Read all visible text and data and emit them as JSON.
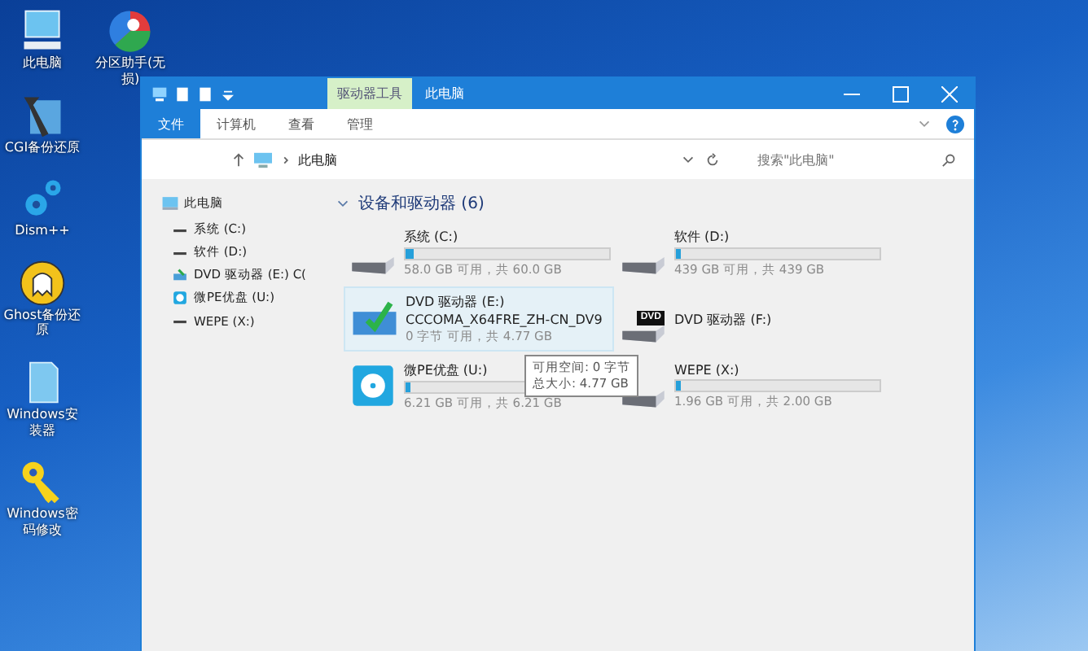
{
  "desktop_icons": [
    {
      "kind": "pc",
      "label": "此电脑"
    },
    {
      "kind": "partition",
      "label": "分区助手(无损)"
    },
    {
      "kind": "tool",
      "label": "CGI备份还原"
    },
    {
      "kind": "gears",
      "label": "Dism++"
    },
    {
      "kind": "ghost",
      "label": "Ghost备份还原"
    },
    {
      "kind": "installer",
      "label": "Windows安装器"
    },
    {
      "kind": "key",
      "label": "Windows密码修改"
    }
  ],
  "window": {
    "title": "此电脑",
    "context_tab": "驱动器工具",
    "tabs": [
      {
        "label": "文件",
        "selected": true
      },
      {
        "label": "计算机",
        "selected": false
      },
      {
        "label": "查看",
        "selected": false
      },
      {
        "label": "管理",
        "selected": false
      }
    ],
    "address": {
      "path": "此电脑"
    },
    "search": {
      "placeholder": "搜索\"此电脑\""
    },
    "sidebar": {
      "items": [
        {
          "kind": "pc",
          "label": "此电脑",
          "children": [
            {
              "kind": "hdd",
              "label": "系统 (C:)"
            },
            {
              "kind": "hdd",
              "label": "软件 (D:)"
            },
            {
              "kind": "dvd",
              "label": "DVD 驱动器 (E:) C("
            },
            {
              "kind": "usb",
              "label": "微PE优盘 (U:)"
            },
            {
              "kind": "hdd",
              "label": "WEPE (X:)"
            }
          ]
        }
      ]
    },
    "group": {
      "title": "设备和驱动器 (6)",
      "expanded": true
    },
    "drives": [
      {
        "kind": "hdd",
        "name": "系统 (C:)",
        "level": 0.04,
        "space": "58.0 GB 可用，共 60.0 GB",
        "highlighted": false
      },
      {
        "kind": "hdd",
        "name": "软件 (D:)",
        "level": 0,
        "space": "439 GB 可用，共 439 GB",
        "highlighted": false
      },
      {
        "kind": "dvd-disc",
        "name": "DVD 驱动器 (E:)",
        "volume": "CCCOMA_X64FRE_ZH-CN_DV9",
        "space": "0 字节 可用，共 4.77 GB",
        "highlighted": true
      },
      {
        "kind": "dvd",
        "badge": "DVD",
        "name": "DVD 驱动器 (F:)",
        "highlighted": false
      },
      {
        "kind": "usb",
        "name": "微PE优盘 (U:)",
        "level": 0,
        "space": "6.21 GB 可用，共 6.21 GB",
        "highlighted": false
      },
      {
        "kind": "hdd",
        "name": "WEPE (X:)",
        "level": 0.02,
        "space": "1.96 GB 可用，共 2.00 GB",
        "highlighted": false
      }
    ],
    "tooltip": {
      "lines": [
        "可用空间: 0 字节",
        "总大小: 4.77 GB"
      ]
    }
  }
}
